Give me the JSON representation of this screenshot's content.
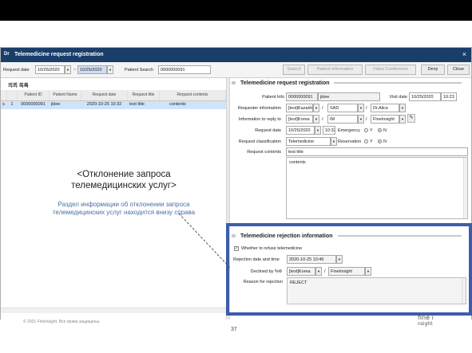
{
  "window": {
    "logo": "Dr",
    "title": "Telemedicine request registration",
    "close": "×"
  },
  "toolbar": {
    "request_date_label": "Request date",
    "date_from": "10/25/2020",
    "sep": "~",
    "date_to": "10/25/2020",
    "patient_search_label": "Patient Search",
    "patient_search_value": "0000000091",
    "buttons": [
      "Search",
      "Patient information",
      "Video Conference",
      "Deny",
      "Close"
    ]
  },
  "list": {
    "title": "의뢰 목록",
    "columns": [
      "Patient ID",
      "Patient Name",
      "Request date",
      "Request title",
      "Request contents"
    ],
    "rows": [
      {
        "mark": "s",
        "idx": "1",
        "id": "0000000091",
        "name": "jklee",
        "date": "2020-10-25 10:32",
        "title": "test title",
        "contents": "contents"
      }
    ]
  },
  "registration": {
    "title": "Telemedicine request registration",
    "patient_info_label": "Patient Info",
    "patient_id": "0000000091",
    "patient_name": "jklee",
    "visit_date_label": "Visit date",
    "visit_date": "10/25/2020",
    "visit_time": "10:23",
    "requester_label": "Requester information",
    "requester_hosp": "[test]Kazakh",
    "requester_dept": "SAD",
    "requester_doc": "Dr.Alice",
    "reply_label": "Information to reply to",
    "reply_hosp": "[test]Korea",
    "reply_dept": "IM",
    "reply_doc": "FineInsight",
    "slash": "/",
    "req_date_label": "Request date",
    "req_date": "10/25/2020",
    "req_time": "10:32",
    "emergency_label": "Emergency",
    "yes": "Y",
    "no": "N",
    "classification_label": "Request classification",
    "classification": "Telemedicine",
    "reservation_label": "Reservation",
    "contents_label": "Request contents",
    "req_title": "test title",
    "req_contents": "contents"
  },
  "rejection": {
    "title": "Telemedicine rejection information",
    "whether_label": "Whether to refuse telemedicine",
    "reject_dt_label": "Rejection date and time",
    "reject_dt": "2020-10-25 10:46",
    "declined_label": "Declined by %Ф",
    "declined_hosp": "[test]Korea",
    "declined_doc": "FineInsight",
    "reason_label": "Reason for rejection",
    "reason": "REJECT"
  },
  "overlay": {
    "title": "<Отклонение запроса телемедицинских услуг>",
    "description": "Раздел информации об отклонении запроса телемедицинских услуг находится внизу справа"
  },
  "footer": {
    "copyright": "© 2021 FineInsight. Все права защищены.",
    "page": "37",
    "brand_line1": "fine i",
    "brand_line2": "nsight"
  },
  "colors": {
    "accent": "#3d5da8",
    "titlebar": "#1a3e6a",
    "row_selected": "#cfe4fb"
  }
}
